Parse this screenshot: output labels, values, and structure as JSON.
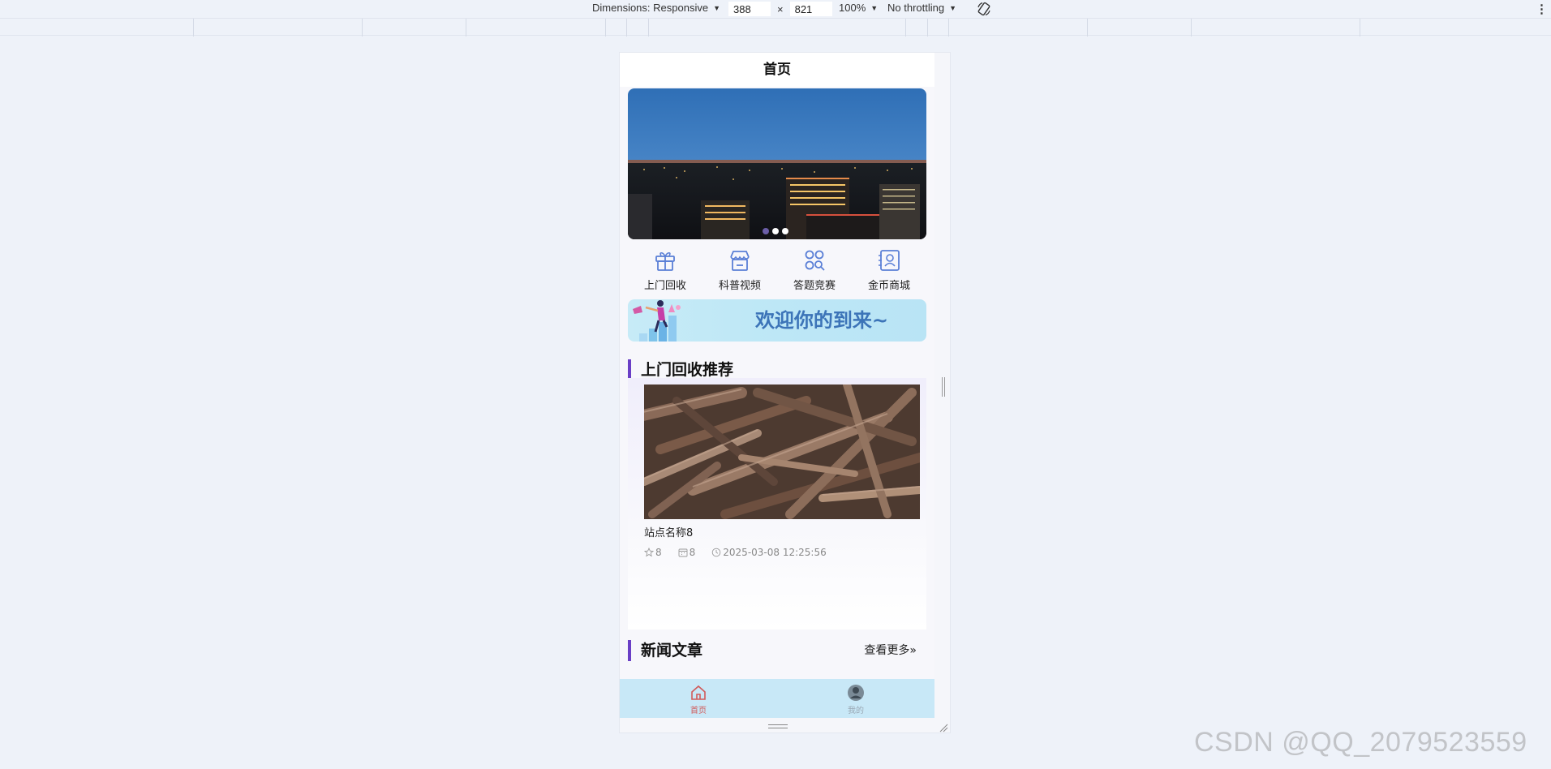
{
  "devtools": {
    "dimensions_label": "Dimensions: Responsive",
    "width": "388",
    "height": "821",
    "times": "×",
    "zoom": "100%",
    "throttling": "No throttling",
    "menu": "⋮"
  },
  "page": {
    "title": "首页",
    "banner": {
      "dots": 3,
      "active_dot": 0
    },
    "quick_menu": [
      {
        "label": "上门回收",
        "icon": "gift-icon"
      },
      {
        "label": "科普视频",
        "icon": "store-icon"
      },
      {
        "label": "答题竞赛",
        "icon": "grid-search-icon"
      },
      {
        "label": "金币商城",
        "icon": "contact-card-icon"
      }
    ],
    "welcome_text": "欢迎你的到来~",
    "recommend": {
      "section_title": "上门回收推荐",
      "item": {
        "name": "站点名称8",
        "likes": "8",
        "views": "8",
        "time": "2025-03-08 12:25:56"
      }
    },
    "news": {
      "section_title": "新闻文章",
      "more_label": "查看更多"
    },
    "tabbar": [
      {
        "label": "首页",
        "icon": "home-icon",
        "active": true
      },
      {
        "label": "我的",
        "icon": "avatar-icon",
        "active": false
      }
    ]
  },
  "watermark": "CSDN @QQ_2079523559",
  "colors": {
    "accent": "#6a3fc6",
    "icon_blue": "#5a7fd6",
    "tabbar_bg": "#c8e8f7",
    "welcome_text": "#3c74b8"
  }
}
